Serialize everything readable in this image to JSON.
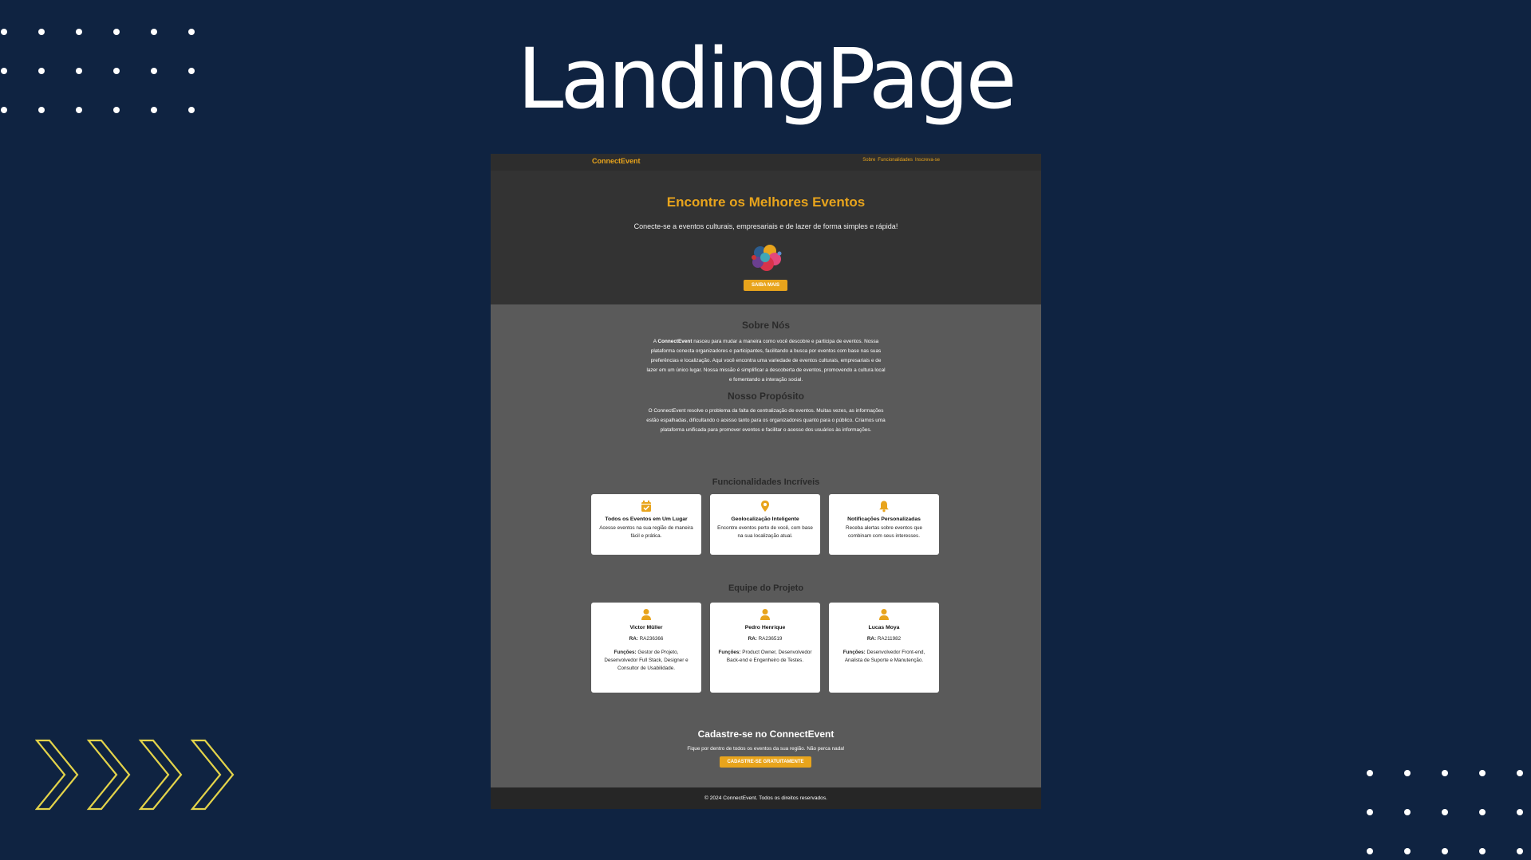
{
  "slide": {
    "title": "LandingPage",
    "accent_color": "#e8a41c",
    "background_color": "#0f2341",
    "chevron_color": "#e3d34a"
  },
  "site": {
    "nav": {
      "brand": "ConnectEvent",
      "links": [
        "Sobre",
        "Funcionalidades",
        "Inscreva-se"
      ]
    },
    "hero": {
      "title": "Encontre os Melhores Eventos",
      "subtitle": "Conecte-se a eventos culturais, empresariais e de lazer de forma simples e rápida!",
      "button": "SAIBA MAIS",
      "logo_icon": "colorful-people-cluster-logo"
    },
    "about": {
      "title": "Sobre Nós",
      "lead": "ConnectEvent",
      "text_before": "A ",
      "text": " nasceu para mudar a maneira como você descobre e participa de eventos. Nossa plataforma conecta organizadores e participantes, facilitando a busca por eventos com base nas suas preferências e localização. Aqui você encontra uma variedade de eventos culturais, empresariais e de lazer em um único lugar. Nossa missão é simplificar a descoberta de eventos, promovendo a cultura local e fomentando a interação social."
    },
    "purpose": {
      "title": "Nosso Propósito",
      "text": "O ConnectEvent resolve o problema da falta de centralização de eventos. Muitas vezes, as informações estão espalhadas, dificultando o acesso tanto para os organizadores quanto para o público. Criamos uma plataforma unificada para promover eventos e facilitar o acesso dos usuários às informações."
    },
    "features": {
      "title": "Funcionalidades Incríveis",
      "items": [
        {
          "icon": "calendar-check-icon",
          "title": "Todos os Eventos em Um Lugar",
          "text": "Acesse eventos na sua região de maneira fácil e prática."
        },
        {
          "icon": "map-pin-icon",
          "title": "Geolocalização Inteligente",
          "text": "Encontre eventos perto de você, com base na sua localização atual."
        },
        {
          "icon": "bell-icon",
          "title": "Notificações Personalizadas",
          "text": "Receba alertas sobre eventos que combinam com seus interesses."
        }
      ]
    },
    "team": {
      "title": "Equipe do Projeto",
      "ra_label": "RA:",
      "roles_label": "Funções:",
      "members": [
        {
          "icon": "user-icon",
          "name": "Victor Müller",
          "ra": "RA236366",
          "roles": "Gestor de Projeto, Desenvolvedor Full Stack, Designer e Consultor de Usabilidade."
        },
        {
          "icon": "user-icon",
          "name": "Pedro Henrique",
          "ra": "RA236519",
          "roles": "Product Owner, Desenvolvedor Back-end e Engenheiro de Testes."
        },
        {
          "icon": "user-icon",
          "name": "Lucas Moya",
          "ra": "RA211982",
          "roles": "Desenvolvedor Front-end, Analista de Suporte e Manutenção."
        }
      ]
    },
    "cta": {
      "title": "Cadastre-se no ConnectEvent",
      "subtitle": "Fique por dentro de todos os eventos da sua região. Não perca nada!",
      "button": "CADASTRE-SE GRATUITAMENTE"
    },
    "footer": "© 2024 ConnectEvent. Todos os direitos reservados."
  }
}
